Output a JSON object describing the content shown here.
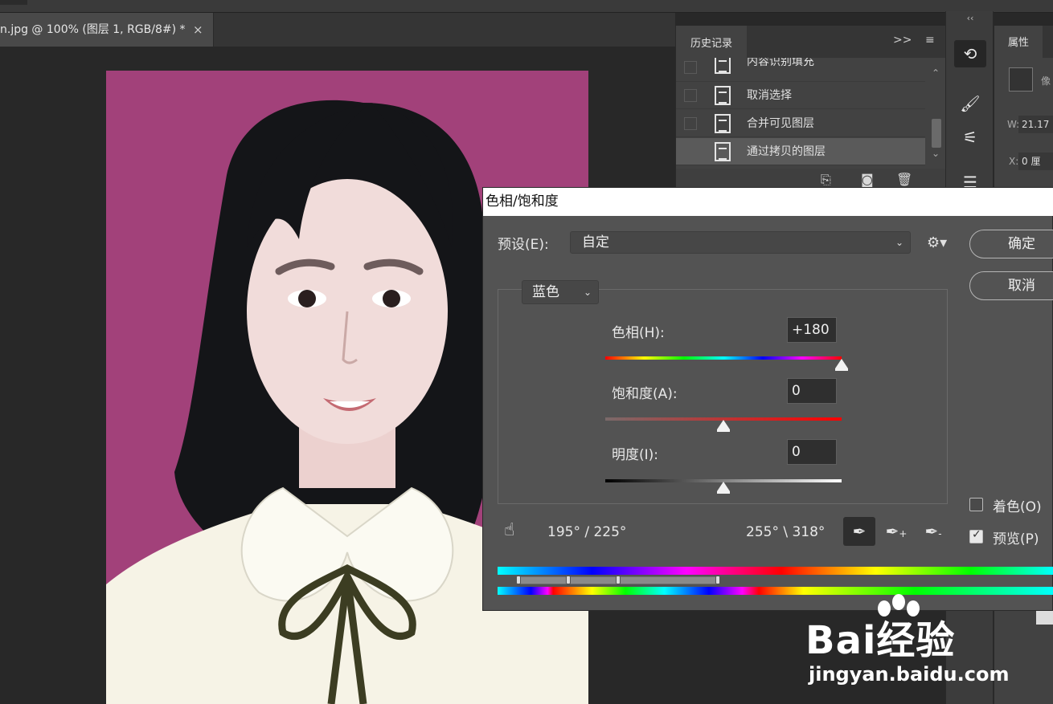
{
  "document_tab": {
    "title": "n.jpg  @  100%  (图层 1, RGB/8#) *",
    "close": "×"
  },
  "history_panel": {
    "tab_label": "历史记录",
    "expand": ">>",
    "menu": "≡",
    "items": [
      {
        "label": "内容识别填充",
        "selected": false
      },
      {
        "label": "取消选择",
        "selected": false
      },
      {
        "label": "合并可见图层",
        "selected": false
      },
      {
        "label": "通过拷贝的图层",
        "selected": true
      }
    ],
    "scroll_up": "⌃",
    "scroll_down": "⌄"
  },
  "tool_column": {
    "collapse": "‹‹"
  },
  "properties_panel": {
    "tab_label": "属性",
    "pixel_label": "像",
    "w_label": "W:",
    "w_value": "21.17",
    "x_label": "X:",
    "x_value": "0 厘"
  },
  "dialog": {
    "title": "色相/饱和度",
    "preset_label": "预设(E):",
    "preset_value": "自定",
    "ok": "确定",
    "cancel": "取消",
    "channel": "蓝色",
    "hue_label": "色相(H):",
    "hue_value": "+180",
    "saturation_label": "饱和度(A):",
    "saturation_value": "0",
    "lightness_label": "明度(I):",
    "lightness_value": "0",
    "range_left": "195° /  225°",
    "range_right": "255° \\  318°",
    "colorize_label": "着色(O)",
    "colorize_checked": false,
    "preview_label": "预览(P)",
    "preview_checked": true,
    "slider_positions": {
      "hue": 1.0,
      "saturation": 0.5,
      "lightness": 0.5
    }
  },
  "watermark": {
    "brand": "Bai经验",
    "url": "jingyan.baidu.com"
  },
  "colors": {
    "photo_background": "#a2417a",
    "panel": "#424242",
    "dialog": "#535353"
  }
}
